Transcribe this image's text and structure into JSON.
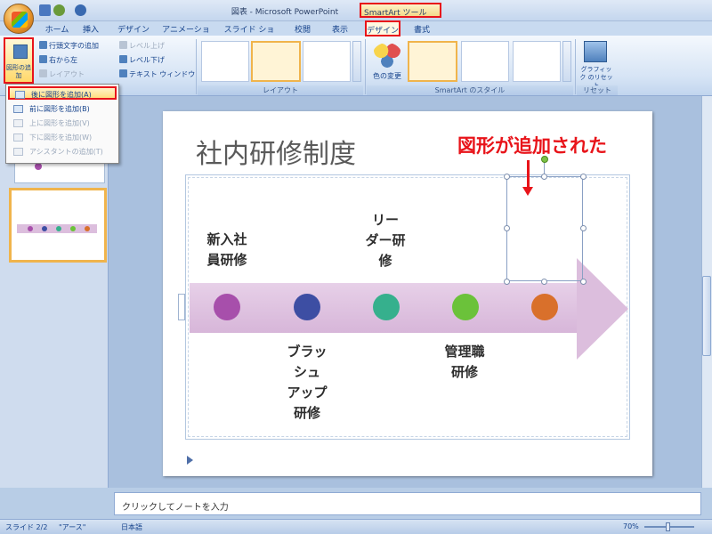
{
  "window": {
    "title": "図表 - Microsoft PowerPoint",
    "contextual_tool_title": "SmartArt ツール"
  },
  "tabs": [
    "ホーム",
    "挿入",
    "デザイン",
    "アニメーション",
    "スライド ショー",
    "校閲",
    "表示"
  ],
  "contextual_tabs": [
    "デザイン",
    "書式"
  ],
  "ribbon": {
    "create_graphic": {
      "add_shape_label": "図形の追加",
      "items": [
        "行頭文字の追加",
        "右から左",
        "レイアウト"
      ],
      "level_items": [
        "レベル上げ",
        "レベル下げ",
        "テキスト ウィンドウ"
      ]
    },
    "layouts_group_label": "レイアウト",
    "color_change_label": "色の変更",
    "styles_group_label": "SmartArt のスタイル",
    "reset_label": "グラフィック のリセット",
    "reset_group_label": "リセット"
  },
  "dropdown": {
    "items": [
      "後に図形を追加(A)",
      "前に図形を追加(B)",
      "上に図形を追加(V)",
      "下に図形を追加(W)",
      "アシスタントの追加(T)"
    ]
  },
  "slide": {
    "title": "社内研修制度",
    "annotation": "図形が追加された",
    "labels_top": [
      "新入社\n員研修",
      "リー\nダー研\n修"
    ],
    "labels_bottom": [
      "ブラッ\nシュ\nアップ\n研修",
      "管理職\n研修"
    ]
  },
  "nodes": [
    {
      "name": "node-1",
      "color": "#a74fab"
    },
    {
      "name": "node-2",
      "color": "#3d4ea3"
    },
    {
      "name": "node-3",
      "color": "#36b08d"
    },
    {
      "name": "node-4",
      "color": "#6bc23a"
    },
    {
      "name": "node-5",
      "color": "#d9702b"
    }
  ],
  "notes": {
    "placeholder": "クリックしてノートを入力"
  },
  "status": {
    "slide_info": "スライド 2/2",
    "theme": "\"アース\"",
    "language": "日本語",
    "zoom": "70%"
  },
  "colors": {
    "highlight": "#e8141a",
    "arrow": "#dcbedd",
    "annotation": "#e8141a"
  }
}
